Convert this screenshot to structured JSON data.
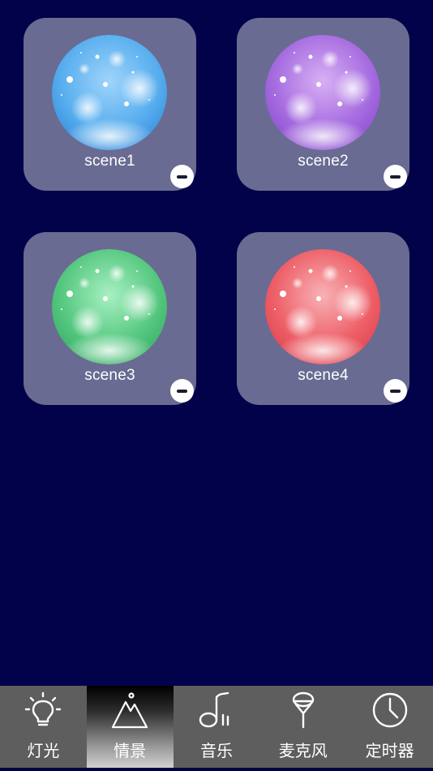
{
  "scenes": [
    {
      "label": "scene1",
      "remove_icon": "minus-icon",
      "color": "#4aa8ec"
    },
    {
      "label": "scene2",
      "remove_icon": "minus-icon",
      "color": "#a66ce0"
    },
    {
      "label": "scene3",
      "remove_icon": "minus-icon",
      "color": "#4ec67a"
    },
    {
      "label": "scene4",
      "remove_icon": "minus-icon",
      "color": "#ec5a62"
    }
  ],
  "tabbar": {
    "tabs": [
      {
        "label": "灯光",
        "icon": "light-bulb-icon",
        "active": false
      },
      {
        "label": "情景",
        "icon": "mountain-icon",
        "active": true
      },
      {
        "label": "音乐",
        "icon": "music-note-icon",
        "active": false
      },
      {
        "label": "麦克风",
        "icon": "microphone-icon",
        "active": false
      },
      {
        "label": "定时器",
        "icon": "clock-icon",
        "active": false
      }
    ]
  },
  "colors": {
    "background": "#02024a",
    "card": "#6a6b92",
    "tabbar": "#5e5e5e"
  }
}
